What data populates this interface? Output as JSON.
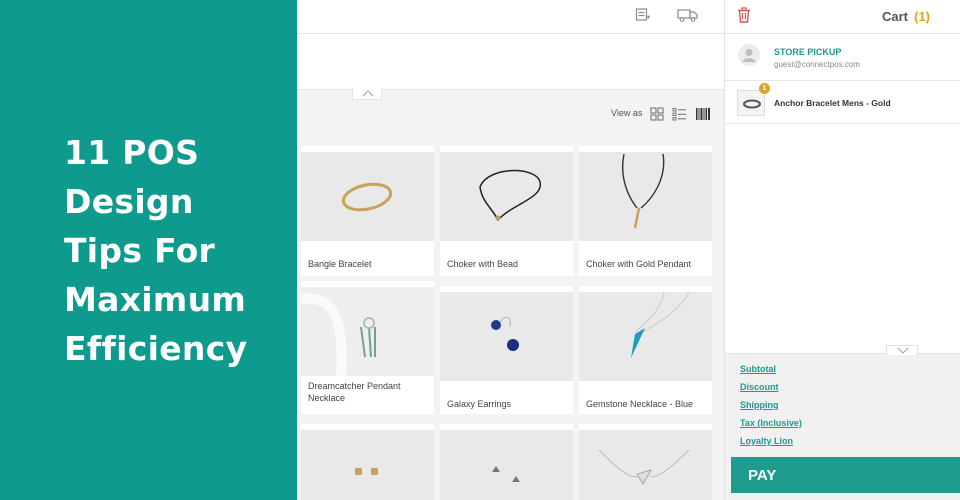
{
  "banner": {
    "title_lines": [
      "11 POS",
      "Design",
      "Tips For",
      "Maximum",
      "Efficiency"
    ]
  },
  "pos": {
    "view_as_label": "View as",
    "view_modes": [
      "grid-view-icon",
      "list-view-icon",
      "barcode-view-icon"
    ],
    "products": [
      {
        "name": "Bangle Bracelet"
      },
      {
        "name": "Choker with Bead"
      },
      {
        "name": "Choker with Gold Pendant"
      },
      {
        "name": "Dreamcatcher Pendant Necklace"
      },
      {
        "name": "Galaxy Earrings"
      },
      {
        "name": "Gemstone Necklace - Blue"
      },
      {
        "name": ""
      },
      {
        "name": ""
      },
      {
        "name": ""
      }
    ]
  },
  "cart": {
    "title": "Cart",
    "count": "(1)",
    "customer": {
      "name": "STORE PICKUP",
      "email": "guest@connectpos.com"
    },
    "items": [
      {
        "qty": "1",
        "name": "Anchor Bracelet Mens - Gold"
      }
    ],
    "totals": [
      "Subtotal",
      "Discount",
      "Shipping",
      "Tax (Inclusive)",
      "Loyalty Lion"
    ],
    "pay_label": "PAY"
  },
  "colors": {
    "brand_teal": "#0f9a8e",
    "accent_teal": "#1e9a8f",
    "badge_orange": "#e3a126"
  }
}
